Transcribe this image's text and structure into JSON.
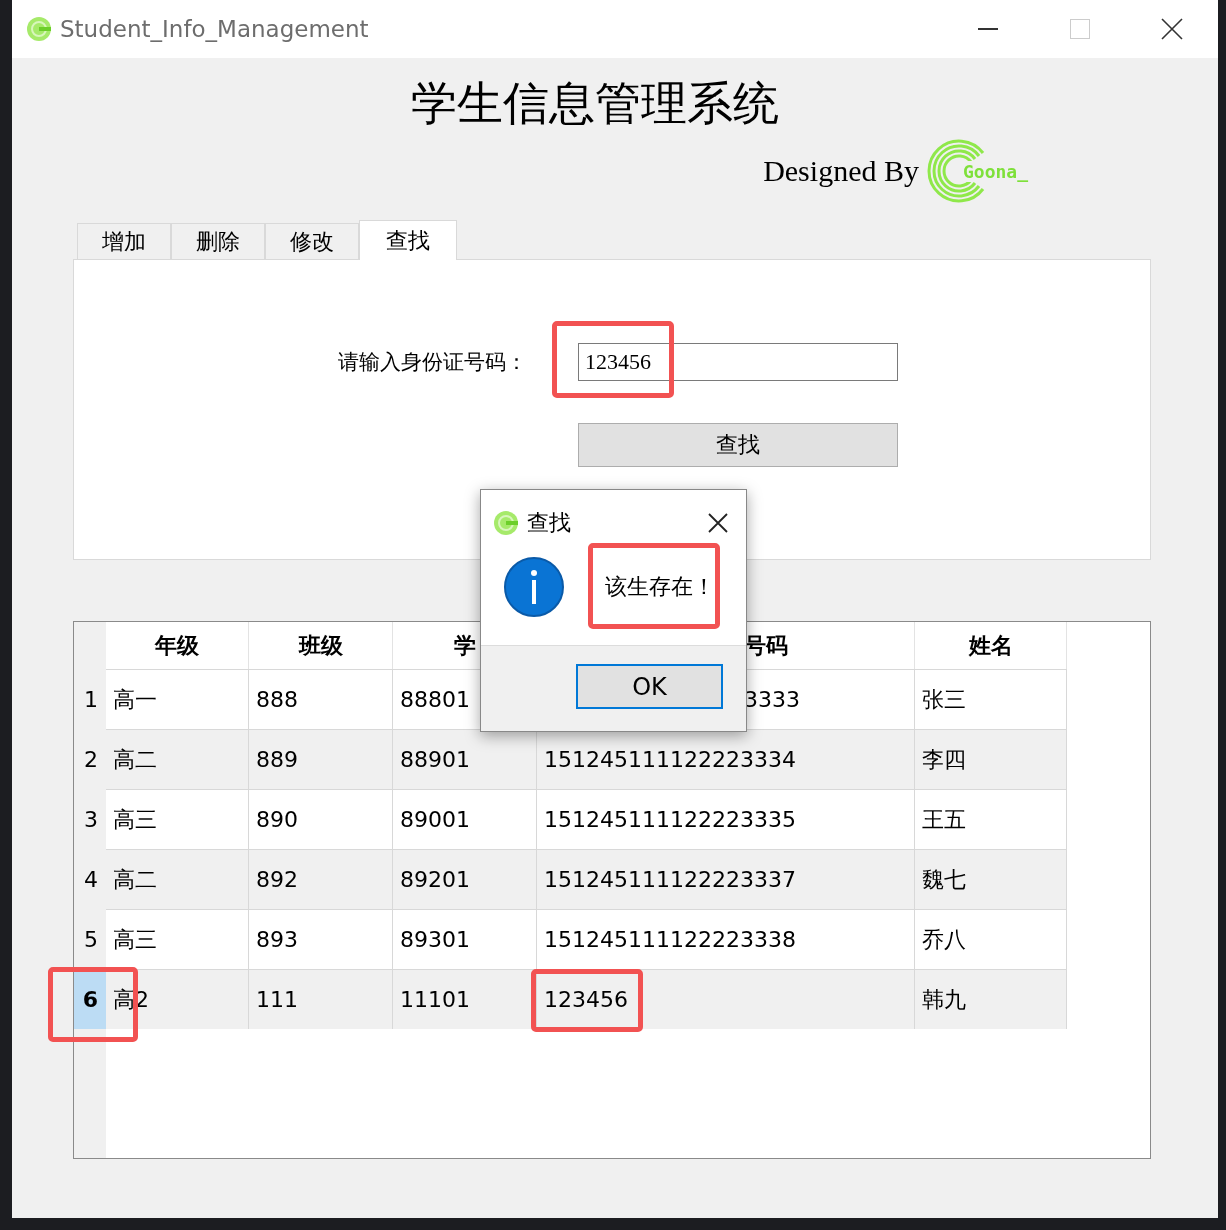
{
  "window": {
    "title": "Student_Info_Management"
  },
  "header": {
    "title": "学生信息管理系统",
    "credit": "Designed By",
    "logo_text": "Goona_"
  },
  "tabs": [
    {
      "label": "增加",
      "selected": false
    },
    {
      "label": "删除",
      "selected": false
    },
    {
      "label": "修改",
      "selected": false
    },
    {
      "label": "查找",
      "selected": true
    }
  ],
  "search": {
    "label": "请输入身份证号码：",
    "value": "123456",
    "highlighted": true,
    "button": "查找"
  },
  "table": {
    "columns": [
      {
        "label": "年级",
        "partial": false
      },
      {
        "label": "班级",
        "partial": false
      },
      {
        "label": "学",
        "partial": false
      },
      {
        "label": "号码",
        "partial": true
      },
      {
        "label": "姓名",
        "partial": false
      }
    ],
    "rows": [
      {
        "number": "1",
        "selected": false,
        "highlighted": false,
        "cells": [
          {
            "text": "高一",
            "partial": false,
            "highlighted": false
          },
          {
            "text": "888",
            "partial": false,
            "highlighted": false
          },
          {
            "text": "88801",
            "partial": false,
            "highlighted": false
          },
          {
            "text": "3333",
            "partial": true,
            "highlighted": false
          },
          {
            "text": "张三",
            "partial": false,
            "highlighted": false
          }
        ]
      },
      {
        "number": "2",
        "selected": false,
        "highlighted": false,
        "cells": [
          {
            "text": "高二",
            "partial": false,
            "highlighted": false
          },
          {
            "text": "889",
            "partial": false,
            "highlighted": false
          },
          {
            "text": "88901",
            "partial": false,
            "highlighted": false
          },
          {
            "text": "151245111122223334",
            "partial": false,
            "highlighted": false
          },
          {
            "text": "李四",
            "partial": false,
            "highlighted": false
          }
        ]
      },
      {
        "number": "3",
        "selected": false,
        "highlighted": false,
        "cells": [
          {
            "text": "高三",
            "partial": false,
            "highlighted": false
          },
          {
            "text": "890",
            "partial": false,
            "highlighted": false
          },
          {
            "text": "89001",
            "partial": false,
            "highlighted": false
          },
          {
            "text": "151245111122223335",
            "partial": false,
            "highlighted": false
          },
          {
            "text": "王五",
            "partial": false,
            "highlighted": false
          }
        ]
      },
      {
        "number": "4",
        "selected": false,
        "highlighted": false,
        "cells": [
          {
            "text": "高二",
            "partial": false,
            "highlighted": false
          },
          {
            "text": "892",
            "partial": false,
            "highlighted": false
          },
          {
            "text": "89201",
            "partial": false,
            "highlighted": false
          },
          {
            "text": "151245111122223337",
            "partial": false,
            "highlighted": false
          },
          {
            "text": "魏七",
            "partial": false,
            "highlighted": false
          }
        ]
      },
      {
        "number": "5",
        "selected": false,
        "highlighted": false,
        "cells": [
          {
            "text": "高三",
            "partial": false,
            "highlighted": false
          },
          {
            "text": "893",
            "partial": false,
            "highlighted": false
          },
          {
            "text": "89301",
            "partial": false,
            "highlighted": false
          },
          {
            "text": "151245111122223338",
            "partial": false,
            "highlighted": false
          },
          {
            "text": "乔八",
            "partial": false,
            "highlighted": false
          }
        ]
      },
      {
        "number": "6",
        "selected": true,
        "highlighted": true,
        "cells": [
          {
            "text": "高2",
            "partial": false,
            "highlighted": false
          },
          {
            "text": "111",
            "partial": false,
            "highlighted": false
          },
          {
            "text": "11101",
            "partial": false,
            "highlighted": false
          },
          {
            "text": "123456",
            "partial": false,
            "highlighted": true
          },
          {
            "text": "韩九",
            "partial": false,
            "highlighted": false
          }
        ]
      }
    ]
  },
  "dialog": {
    "title": "查找",
    "message": "该生存在！",
    "highlighted": true,
    "button": "OK"
  }
}
